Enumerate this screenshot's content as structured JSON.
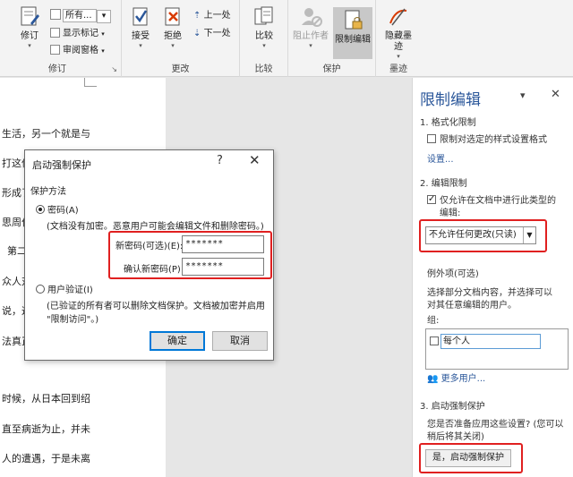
{
  "ribbon": {
    "reply_label": "修订",
    "markup_select": "所有...",
    "show_markup": "显示标记",
    "review_pane": "审阅窗格",
    "tracking_group": "修订",
    "accept": "接受",
    "reject": "拒绝",
    "previous": "上一处",
    "next": "下一处",
    "changes_group": "更改",
    "compare": "比较",
    "compare_group": "比较",
    "block_authors": "阻止作者",
    "restrict_editing": "限制编辑",
    "protect_group": "保护",
    "hide_ink": "隐藏墨",
    "hide_ink2": "迹",
    "ink_group": "墨迹"
  },
  "document": {
    "lines": [
      "生活，另一个就是与",
      "打这件",
      "形成了",
      "思周作",
      "第二",
      "众人对",
      "说，这",
      "法真正",
      "时候，从日本回到绍",
      "直至病逝为止，并未",
      "人的遭遇，于是未离"
    ]
  },
  "dialog": {
    "title": "启动强制保护",
    "help": "?",
    "close": "✕",
    "method_label": "保护方法",
    "password_option": "密码(A)",
    "password_note": "(文档没有加密。恶意用户可能会编辑文件和删除密码。)",
    "new_password_label": "新密码(可选)(E):",
    "new_password_value": "*******",
    "confirm_password_label": "确认新密码(P):",
    "confirm_password_value": "*******",
    "user_auth_option": "用户验证(I)",
    "user_auth_note1": "(已验证的所有者可以删除文档保护。文档被加密并启用",
    "user_auth_note2": "\"限制访问\"。)",
    "ok": "确定",
    "cancel": "取消"
  },
  "pane": {
    "title": "限制编辑",
    "menu": "▾",
    "close": "✕",
    "section1": "1. 格式化限制",
    "section1_check": "限制对选定的样式设置格式",
    "settings_link": "设置...",
    "section2": "2. 编辑限制",
    "section2_check1": "仅允许在文档中进行此类型的",
    "section2_check2": "编辑:",
    "edit_type": "不允许任何更改(只读)",
    "exceptions_title": "例外项(可选)",
    "exceptions_desc1": "选择部分文档内容，并选择可以",
    "exceptions_desc2": "对其任意编辑的用户。",
    "groups_label": "组:",
    "everyone": "每个人",
    "more_users": "更多用户...",
    "section3": "3. 启动强制保护",
    "section3_q1": "您是否准备应用这些设置? (您可以",
    "section3_q2": "稍后将其关闭)",
    "start_button": "是，启动强制保护"
  }
}
